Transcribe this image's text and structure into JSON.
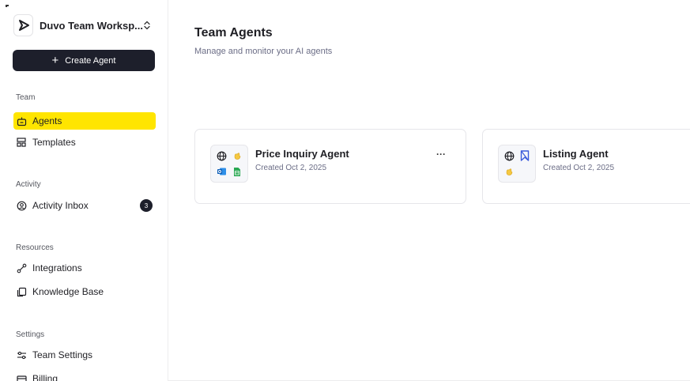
{
  "workspace": {
    "name": "Duvo Team Worksp...",
    "logo_icon": "duvo-logo-icon",
    "switch_icon": "chevron-up-down-icon"
  },
  "create_agent": {
    "label": "Create Agent",
    "icon": "plus"
  },
  "sidebar": {
    "team_label": "Team",
    "team_items": [
      {
        "label": "Agents",
        "icon": "robot-icon",
        "active": true
      },
      {
        "label": "Templates",
        "icon": "templates-icon"
      }
    ],
    "activity_label": "Activity",
    "activity_items": [
      {
        "label": "Activity Inbox",
        "icon": "inbox-icon",
        "badge": "3"
      }
    ],
    "resources_label": "Resources",
    "resources_items": [
      {
        "label": "Integrations",
        "icon": "integrations-icon"
      },
      {
        "label": "Knowledge Base",
        "icon": "copy-icon"
      }
    ],
    "settings_label": "Settings",
    "settings_items": [
      {
        "label": "Team Settings",
        "icon": "sliders-icon"
      },
      {
        "label": "Billing",
        "icon": "billing-icon"
      }
    ]
  },
  "main": {
    "title": "Team Agents",
    "subtitle": "Manage and monitor your AI agents"
  },
  "agents": [
    {
      "name": "Price Inquiry Agent",
      "created": "Created Oct 2, 2025",
      "more": "···",
      "icons": [
        "globe-icon",
        "hand-icon",
        "outlook-icon",
        "sheets-icon"
      ]
    },
    {
      "name": "Listing Agent",
      "created": "Created Oct 2, 2025",
      "icons": [
        "globe-icon",
        "bookmark-icon",
        "hand-icon"
      ]
    }
  ],
  "colors": {
    "accent": "#ffe500",
    "dark": "#1d1f2b",
    "muted": "#6b6d86"
  }
}
